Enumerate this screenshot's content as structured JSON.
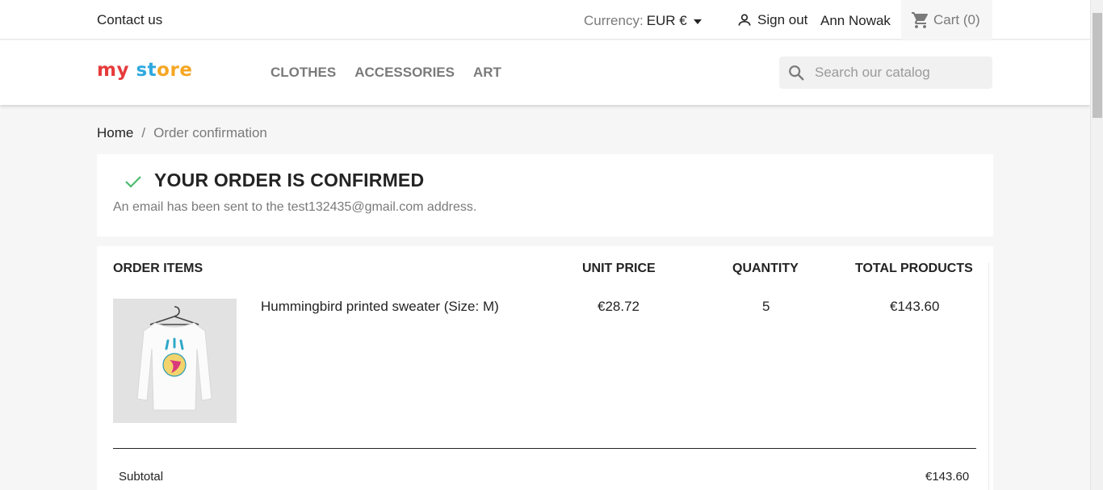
{
  "topnav": {
    "contact": "Contact us",
    "currency_label": "Currency:",
    "currency_value": "EUR €",
    "signout": "Sign out",
    "username": "Ann Nowak",
    "cart": "Cart (0)"
  },
  "header": {
    "logo": [
      "my",
      " ",
      "st",
      "ore"
    ],
    "menu": [
      "CLOTHES",
      "ACCESSORIES",
      "ART"
    ],
    "search_placeholder": "Search our catalog"
  },
  "breadcrumb": {
    "home": "Home",
    "separator": "/",
    "current": "Order confirmation"
  },
  "confirmation": {
    "title": "YOUR ORDER IS CONFIRMED",
    "message": "An email has been sent to the test132435@gmail.com address."
  },
  "order": {
    "headers": {
      "items": "ORDER ITEMS",
      "unit_price": "UNIT PRICE",
      "quantity": "QUANTITY",
      "total": "TOTAL PRODUCTS"
    },
    "rows": [
      {
        "name": "Hummingbird printed sweater (Size: M)",
        "unit_price": "€28.72",
        "quantity": "5",
        "total": "€143.60"
      }
    ],
    "subtotal_label": "Subtotal",
    "subtotal_value": "€143.60"
  },
  "colors": {
    "check": "#4cbb6c",
    "accent": "#24b9d7"
  }
}
